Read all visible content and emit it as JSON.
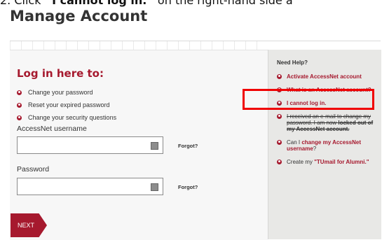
{
  "instruction": {
    "prefix": "2. Click ",
    "bold_text": "“I cannot log in.”",
    "suffix": " on the right-hand side a"
  },
  "page_title": "Manage Account",
  "login": {
    "heading": "Log in here to:",
    "bullets": [
      "Change your password",
      "Reset your expired password",
      "Change your security questions"
    ],
    "username_label": "AccessNet username",
    "password_label": "Password",
    "forgot_label": "Forgot?",
    "next_label": "NEXT"
  },
  "help": {
    "title": "Need Help?",
    "items": [
      {
        "text": "Activate AccessNet account"
      },
      {
        "text": "What is an AccessNet account?"
      },
      {
        "text": "I cannot log in."
      },
      {
        "text": "I received an e-mail to change my password. I am now ",
        "bold": "locked out of my AccessNet account."
      },
      {
        "prefix": "Can I ",
        "link": "change my AccessNet username",
        "suffix": "?"
      },
      {
        "prefix": "Create my ",
        "link": "\"TUmail for Alumni.\""
      }
    ]
  },
  "colors": {
    "brand": "#a6192e",
    "highlight": "#f00000"
  }
}
